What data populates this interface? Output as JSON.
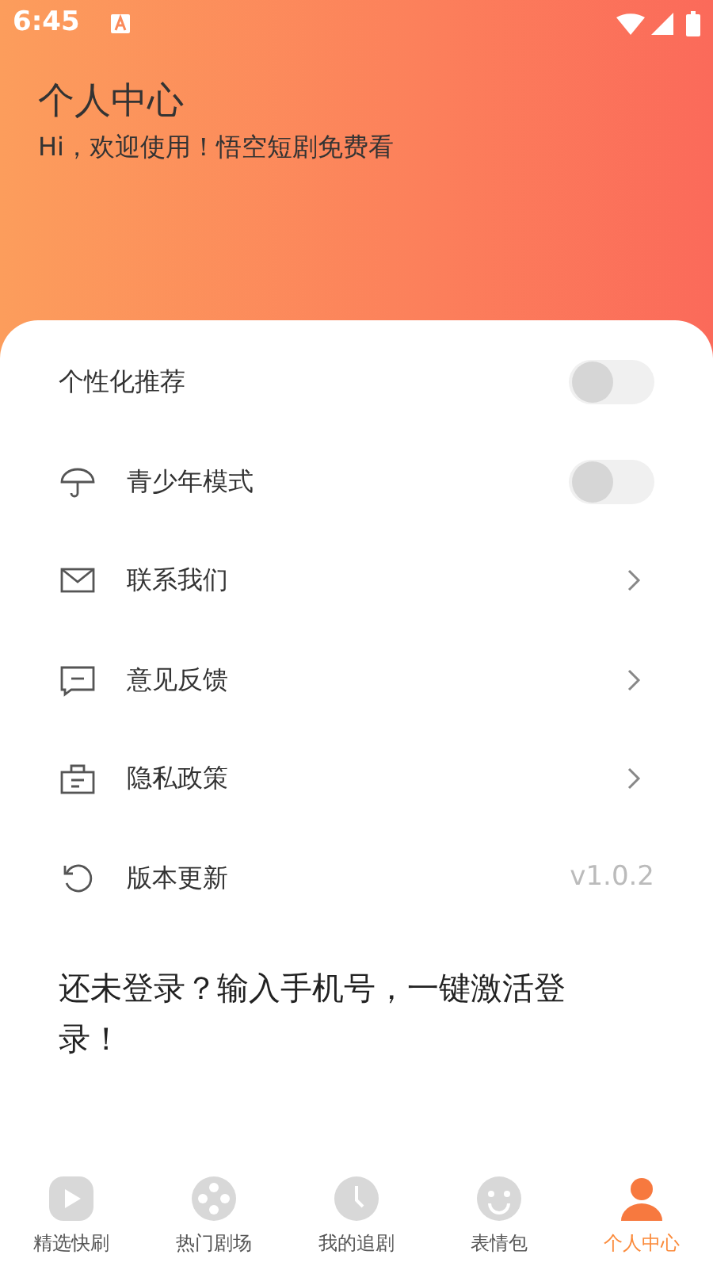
{
  "status_bar": {
    "time": "6:45"
  },
  "header": {
    "title": "个人中心",
    "subtitle": "Hi，欢迎使用！悟空短剧免费看"
  },
  "settings": [
    {
      "kind": "toggle",
      "label": "个性化推荐",
      "on": false
    },
    {
      "kind": "toggle",
      "label": "青少年模式",
      "on": false
    },
    {
      "kind": "link",
      "label": "联系我们"
    },
    {
      "kind": "link",
      "label": "意见反馈"
    },
    {
      "kind": "link",
      "label": "隐私政策"
    },
    {
      "kind": "value",
      "label": "版本更新",
      "value": "v1.0.2"
    }
  ],
  "login_prompt": "还未登录？输入手机号，一键激活登录！",
  "bottom_nav": [
    {
      "label": "精选快刷",
      "selected": false
    },
    {
      "label": "热门剧场",
      "selected": false
    },
    {
      "label": "我的追剧",
      "selected": false
    },
    {
      "label": "表情包",
      "selected": false
    },
    {
      "label": "个人中心",
      "selected": true
    }
  ]
}
